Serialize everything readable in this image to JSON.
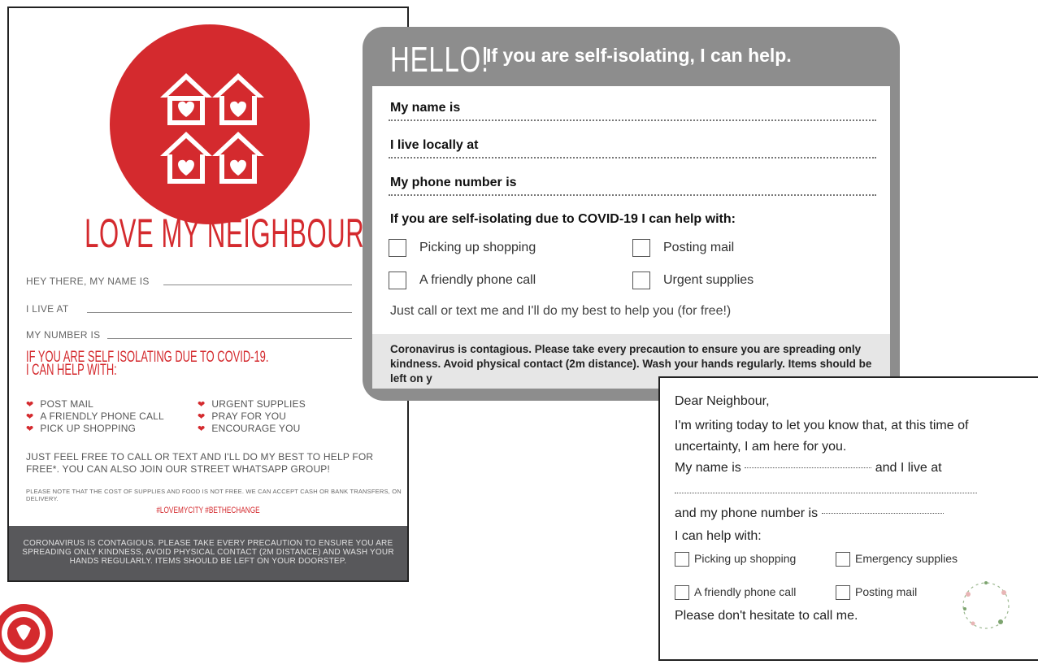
{
  "card1": {
    "title": "LOVE MY NEIGHBOUR",
    "fields": [
      "HEY THERE, MY NAME IS",
      "I LIVE AT",
      "MY NUMBER IS"
    ],
    "subhead_line1": "IF YOU ARE SELF ISOLATING DUE TO COVID-19.",
    "subhead_line2": "I CAN HELP WITH:",
    "help_left": [
      "POST MAIL",
      "A FRIENDLY PHONE CALL",
      "PICK UP SHOPPING"
    ],
    "help_right": [
      "URGENT SUPPLIES",
      "PRAY FOR YOU",
      "ENCOURAGE YOU"
    ],
    "paragraph": "JUST FEEL FREE TO CALL OR TEXT AND I'LL DO MY BEST TO HELP FOR FREE*. YOU CAN ALSO JOIN OUR STREET WHATSAPP GROUP!",
    "small_note": "PLEASE NOTE THAT THE COST OF SUPPLIES AND FOOD IS NOT FREE. WE CAN ACCEPT CASH OR BANK TRANSFERS, ON DELIVERY.",
    "hashtags": "#LOVEMYCITY #BETHECHANGE",
    "footer": "CORONAVIRUS IS CONTAGIOUS. PLEASE TAKE EVERY PRECAUTION TO ENSURE YOU ARE SPREADING ONLY KINDNESS, AVOID PHYSICAL CONTACT (2M DISTANCE) AND WASH YOUR HANDS REGULARLY. ITEMS SHOULD BE LEFT ON YOUR DOORSTEP.",
    "accent": "#d42a2e"
  },
  "card2": {
    "hello": "HELLO!",
    "headline": "If you are self-isolating, I can help.",
    "labels": [
      "My name is",
      "I live locally at",
      "My phone number is"
    ],
    "help_heading": "If you are self-isolating due to COVID-19 I can help with:",
    "options": [
      "Picking up shopping",
      "Posting mail",
      "A friendly phone call",
      "Urgent supplies"
    ],
    "note": "Just call or text me and I'll do my best to help you (for free!)",
    "warning": "Coronavirus is contagious. Please take every precaution to ensure you are spreading only kindness. Avoid physical contact (2m distance). Wash your hands regularly. Items should be left on y"
  },
  "card3": {
    "greeting": "Dear Neighbour,",
    "line1": "I'm writing today to let you know that, at this time of",
    "line2": "uncertainty, I am here for you.",
    "name_prefix": "My name is",
    "name_suffix": "and I live at",
    "phone_prefix": "and my phone number is",
    "help_with": "I can help with:",
    "options": [
      "Picking up shopping",
      "Emergency supplies",
      "A friendly phone call",
      "Posting mail"
    ],
    "closing": "Please don't hesitate to call me.",
    "wreath_text": "love your neighbour"
  }
}
